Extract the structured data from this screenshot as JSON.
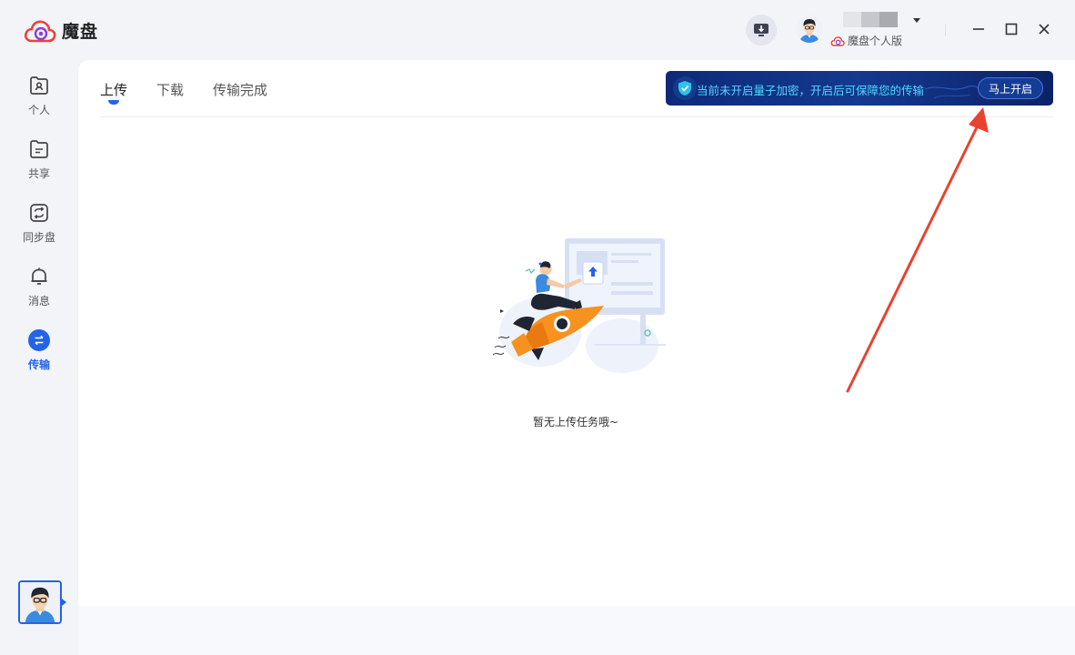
{
  "app": {
    "name": "魔盘"
  },
  "user": {
    "plan": "魔盘个人版"
  },
  "sidebar": {
    "items": [
      {
        "label": "个人",
        "icon": "personal-folder-icon"
      },
      {
        "label": "共享",
        "icon": "shared-folder-icon"
      },
      {
        "label": "同步盘",
        "icon": "sync-icon"
      },
      {
        "label": "消息",
        "icon": "bell-icon"
      },
      {
        "label": "传输",
        "icon": "transfer-icon",
        "active": true
      }
    ]
  },
  "main": {
    "tabs": [
      {
        "label": "上传",
        "active": true
      },
      {
        "label": "下载"
      },
      {
        "label": "传输完成"
      }
    ],
    "banner": {
      "text": "当前未开启量子加密，开启后可保障您的传输",
      "button": "马上开启"
    },
    "empty_state": {
      "text": "暂无上传任务哦~"
    }
  },
  "colors": {
    "accent": "#2463e8",
    "banner_bg": "#0d2a78",
    "banner_text": "#4fd7ff",
    "annotation_arrow": "#e8432f",
    "rocket_orange": "#f7921e"
  }
}
